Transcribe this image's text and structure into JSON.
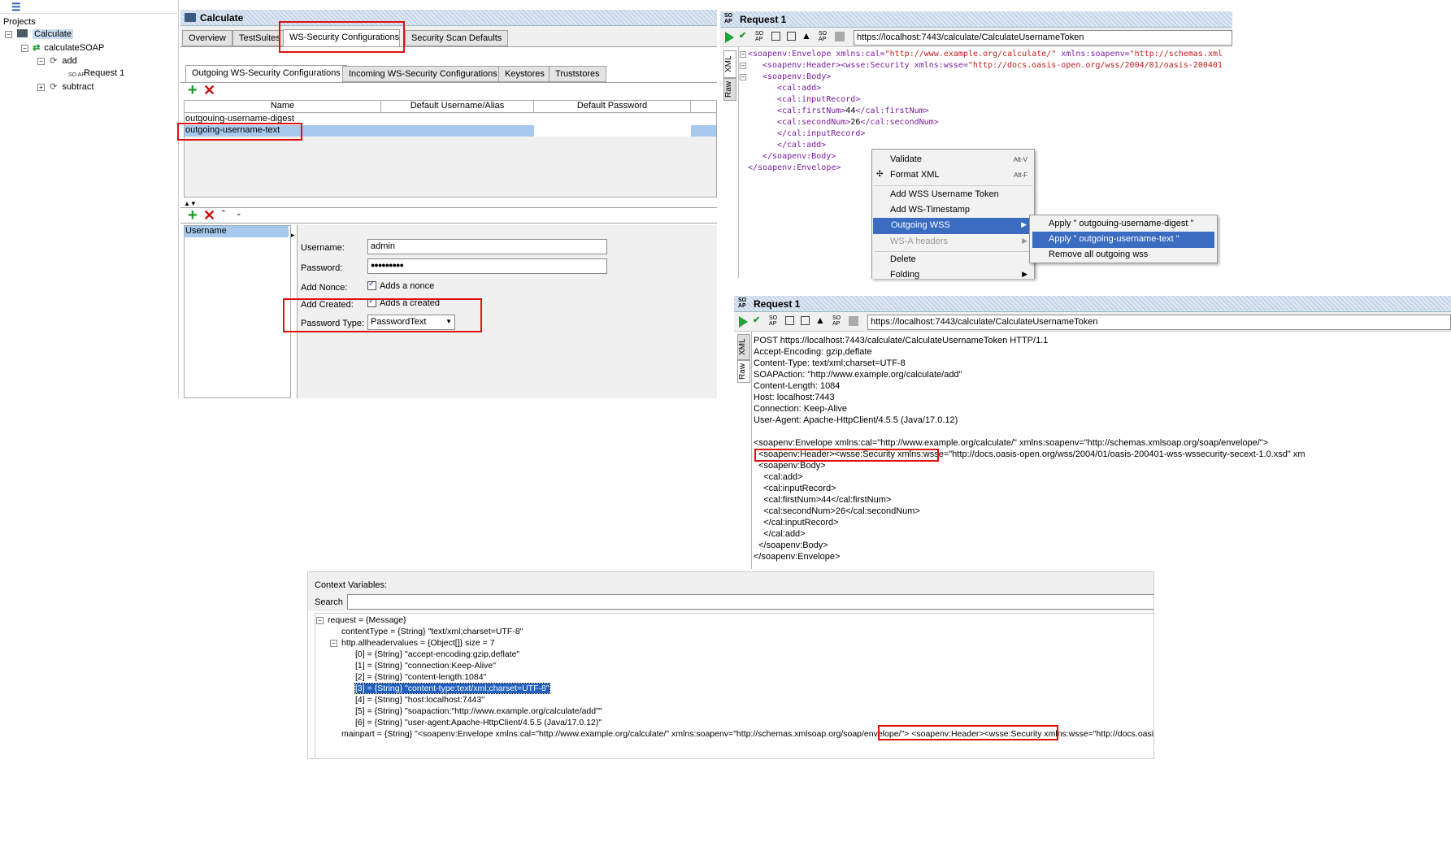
{
  "navigator": {
    "root": "Projects",
    "project": "Calculate",
    "interface": "calculateSOAP",
    "operation_add": "add",
    "request": "Request 1",
    "operation_subtract": "subtract",
    "soap_icon_text": "SO AP"
  },
  "project_panel": {
    "title": "Calculate",
    "tabs": [
      "Overview",
      "TestSuites",
      "WS-Security Configurations",
      "Security Scan Defaults"
    ],
    "subtabs": [
      "Outgoing WS-Security Configurations",
      "Incoming WS-Security Configurations",
      "Keystores",
      "Truststores"
    ],
    "columns": [
      "Name",
      "Default Username/Alias",
      "Default Password"
    ],
    "rows": [
      "outgouing-username-digest",
      "outgoing-username-text"
    ],
    "entry_list": [
      "Username"
    ],
    "form": {
      "username_label": "Username:",
      "username": "admin",
      "password_label": "Password:",
      "password": "●●●●●●●●●",
      "nonce_label": "Add Nonce:",
      "nonce_text": "Adds a nonce",
      "created_label": "Add Created:",
      "created_text": "Adds a created",
      "ptype_label": "Password Type:",
      "ptype": "PasswordText"
    }
  },
  "request_top": {
    "title": "Request 1",
    "url": "https://localhost:7443/calculate/CalculateUsernameToken",
    "xml_tab": "XML",
    "raw_tab": "Raw",
    "xml_lines": [
      {
        "indent": 0,
        "parts": [
          [
            "t",
            "<soapenv:Envelope "
          ],
          [
            "a",
            "xmlns:cal="
          ],
          [
            "v",
            "\"http://www.example.org/calculate/\" "
          ],
          [
            "a",
            "xmlns:soapenv="
          ],
          [
            "v",
            "\"http://schemas.xml"
          ]
        ]
      },
      {
        "indent": 1,
        "parts": [
          [
            "t",
            "<soapenv:Header><wsse:Security "
          ],
          [
            "a",
            "xmlns:wsse="
          ],
          [
            "v",
            "\"http://docs.oasis-open.org/wss/2004/01/oasis-200401"
          ]
        ]
      },
      {
        "indent": 1,
        "parts": [
          [
            "t",
            "<soapenv:Body>"
          ]
        ]
      },
      {
        "indent": 2,
        "parts": [
          [
            "t",
            "<cal:add>"
          ]
        ]
      },
      {
        "indent": 2,
        "parts": [
          [
            "t",
            "<cal:inputRecord>"
          ]
        ]
      },
      {
        "indent": 2,
        "parts": [
          [
            "t",
            "<cal:firstNum>"
          ],
          [
            "b",
            "44"
          ],
          [
            "t",
            "</cal:firstNum>"
          ]
        ]
      },
      {
        "indent": 2,
        "parts": [
          [
            "t",
            "<cal:secondNum>"
          ],
          [
            "b",
            "26"
          ],
          [
            "t",
            "</cal:secondNum>"
          ]
        ]
      },
      {
        "indent": 2,
        "parts": [
          [
            "t",
            "</cal:inputRecord>"
          ]
        ]
      },
      {
        "indent": 2,
        "parts": [
          [
            "t",
            "</cal:add>"
          ]
        ]
      },
      {
        "indent": 1,
        "parts": [
          [
            "t",
            "</soapenv:Body>"
          ]
        ]
      },
      {
        "indent": 0,
        "parts": [
          [
            "t",
            "</soapenv:Envelope>"
          ]
        ]
      }
    ]
  },
  "context_menu": {
    "items": [
      {
        "label": "Validate",
        "shortcut": "Alt-V"
      },
      {
        "label": "Format XML",
        "shortcut": "Alt-F"
      },
      {
        "label": "Add WSS Username Token"
      },
      {
        "label": "Add WS-Timestamp"
      },
      {
        "label": "Outgoing WSS"
      },
      {
        "label": "WS-A headers"
      },
      {
        "label": "Delete"
      },
      {
        "label": "Folding"
      }
    ]
  },
  "submenu": {
    "items": [
      "Apply \" outgouing-username-digest \"",
      "Apply \" outgoing-username-text \"",
      "Remove all outgoing wss"
    ]
  },
  "request_raw": {
    "title": "Request 1",
    "url": "https://localhost:7443/calculate/CalculateUsernameToken",
    "xml_tab": "XML",
    "raw_tab": "Raw",
    "lines": [
      "POST https://localhost:7443/calculate/CalculateUsernameToken HTTP/1.1",
      "Accept-Encoding: gzip,deflate",
      "Content-Type: text/xml;charset=UTF-8",
      "SOAPAction: \"http://www.example.org/calculate/add\"",
      "Content-Length: 1084",
      "Host: localhost:7443",
      "Connection: Keep-Alive",
      "User-Agent: Apache-HttpClient/4.5.5 (Java/17.0.12)",
      "",
      "<soapenv:Envelope xmlns:cal=\"http://www.example.org/calculate/\" xmlns:soapenv=\"http://schemas.xmlsoap.org/soap/envelope/\">",
      "  <soapenv:Header><wsse:Security xmlns:wsse=\"http://docs.oasis-open.org/wss/2004/01/oasis-200401-wss-wssecurity-secext-1.0.xsd\" xm",
      "  <soapenv:Body>",
      "    <cal:add>",
      "    <cal:inputRecord>",
      "    <cal:firstNum>44</cal:firstNum>",
      "    <cal:secondNum>26</cal:secondNum>",
      "    </cal:inputRecord>",
      "    </cal:add>",
      "  </soapenv:Body>",
      "</soapenv:Envelope>"
    ]
  },
  "context_vars": {
    "title": "Context Variables:",
    "search_label": "Search",
    "tree": [
      {
        "i": 0,
        "t": "request = {Message}",
        "exp": true
      },
      {
        "i": 1,
        "t": "contentType = {String} \"text/xml;charset=UTF-8\""
      },
      {
        "i": 1,
        "t": "http.allheadervalues = {Object[]} size = 7",
        "exp": true
      },
      {
        "i": 2,
        "t": "[0] = {String} \"accept-encoding:gzip,deflate\""
      },
      {
        "i": 2,
        "t": "[1] = {String} \"connection:Keep-Alive\""
      },
      {
        "i": 2,
        "t": "[2] = {String} \"content-length:1084\""
      },
      {
        "i": 2,
        "t": "[3] = {String} \"content-type:text/xml;charset=UTF-8\"",
        "sel": true
      },
      {
        "i": 2,
        "t": "[4] = {String} \"host:localhost:7443\""
      },
      {
        "i": 2,
        "t": "[5] = {String} \"soapaction:\"http://www.example.org/calculate/add\"\""
      },
      {
        "i": 2,
        "t": "[6] = {String} \"user-agent:Apache-HttpClient/4.5.5 (Java/17.0.12)\""
      },
      {
        "i": 1,
        "t": "mainpart = {String} \"<soapenv:Envelope xmlns:cal=\"http://www.example.org/calculate/\" xmlns:soapenv=\"http://schemas.xmlsoap.org/soap/envelope/\">  <soapenv:Header><wsse:Security xmlns:wsse=\"http://docs.oasis-open.org/w"
      }
    ]
  }
}
